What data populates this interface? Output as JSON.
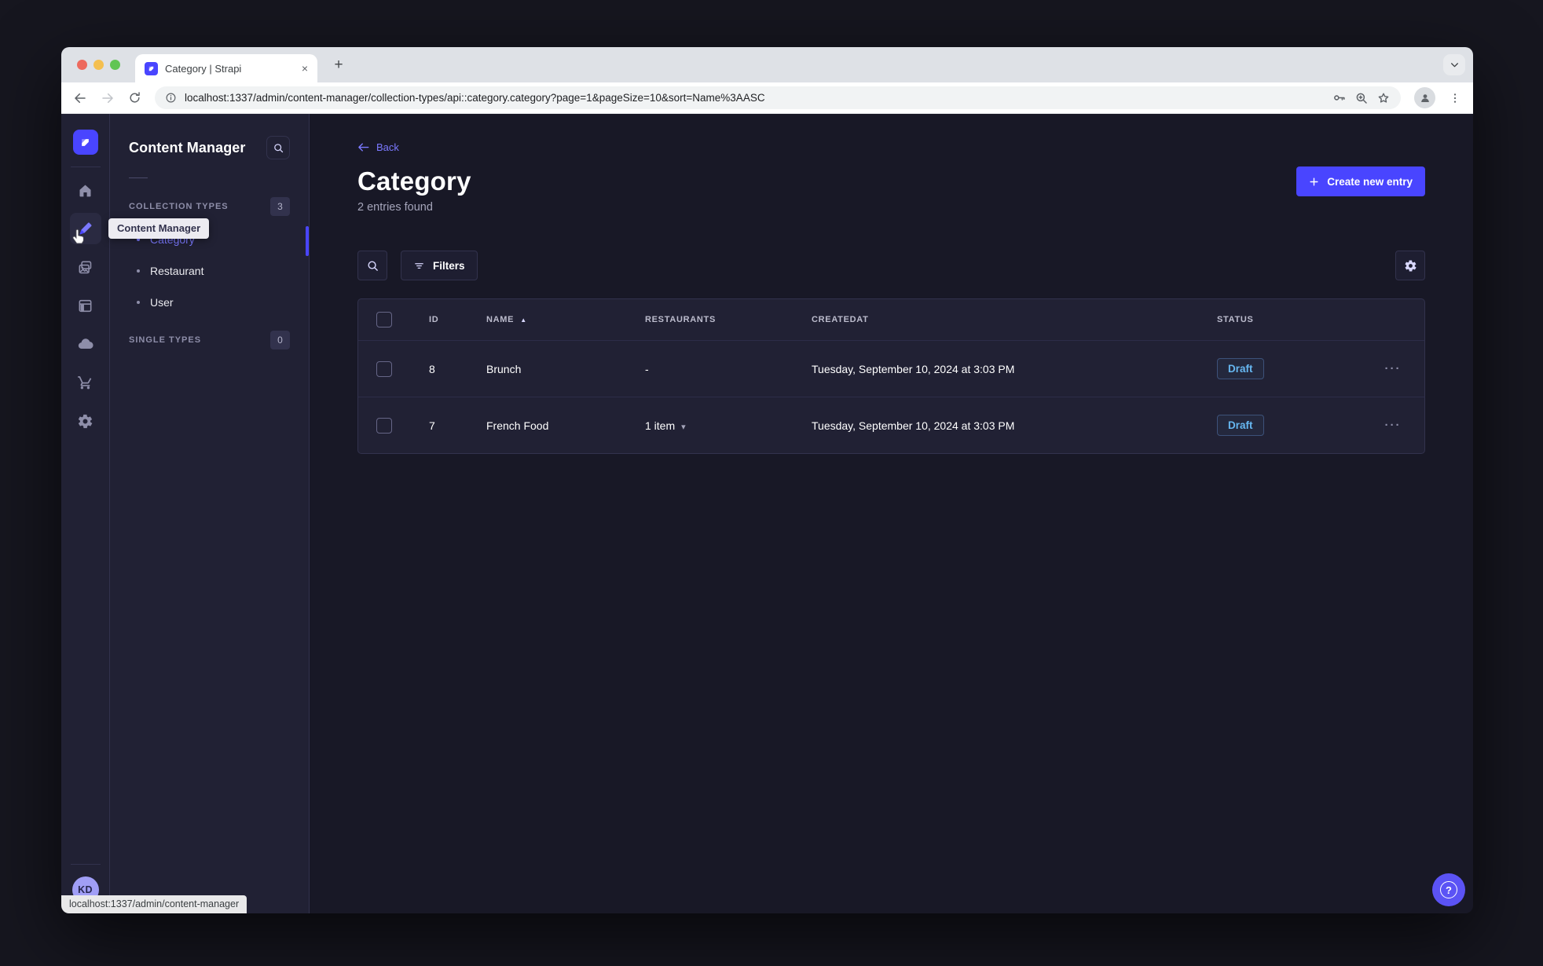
{
  "browser": {
    "tab_title": "Category | Strapi",
    "url": "localhost:1337/admin/content-manager/collection-types/api::category.category?page=1&pageSize=10&sort=Name%3AASC",
    "status_tooltip": "localhost:1337/admin/content-manager"
  },
  "glyphs": {
    "new_tab_plus": "+",
    "tab_close": "×",
    "row_actions_dots": "···",
    "sort_asc": "▲",
    "caret_down": "▾",
    "help_question": "?"
  },
  "rail": {
    "tooltip": "Content Manager",
    "avatar_initials": "KD"
  },
  "subsidebar": {
    "title": "Content Manager",
    "sections": [
      {
        "label": "COLLECTION TYPES",
        "badge": "3",
        "items": [
          {
            "label": "Category",
            "active": true
          },
          {
            "label": "Restaurant",
            "active": false
          },
          {
            "label": "User",
            "active": false
          }
        ]
      },
      {
        "label": "SINGLE TYPES",
        "badge": "0",
        "items": []
      }
    ]
  },
  "main": {
    "back_label": "Back",
    "title": "Category",
    "subtitle": "2 entries found",
    "create_button_label": "Create new entry",
    "filters_label": "Filters"
  },
  "table": {
    "columns": [
      "ID",
      "NAME",
      "RESTAURANTS",
      "CREATEDAT",
      "STATUS"
    ],
    "rows": [
      {
        "id": "8",
        "name": "Brunch",
        "restaurants": "-",
        "created_at": "Tuesday, September 10, 2024 at 3:03 PM",
        "status": "Draft"
      },
      {
        "id": "7",
        "name": "French Food",
        "restaurants": "1 item",
        "created_at": "Tuesday, September 10, 2024 at 3:03 PM",
        "status": "Draft"
      }
    ]
  },
  "colors": {
    "primary": "#4945ff",
    "primary_light": "#7b79ff",
    "draft_blue": "#66b7f1",
    "app_bg": "#181826",
    "surface": "#212134",
    "border": "#32324d"
  }
}
